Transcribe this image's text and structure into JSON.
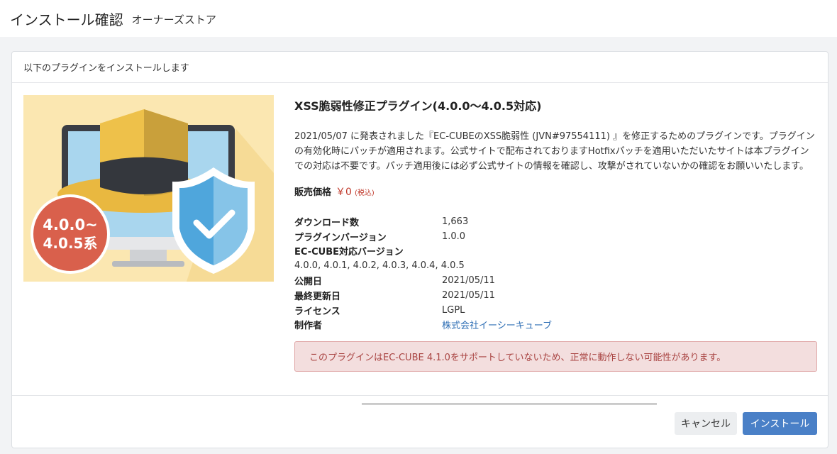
{
  "header": {
    "title": "インストール確認",
    "subtitle": "オーナーズストア"
  },
  "card": {
    "heading": "以下のプラグインをインストールします"
  },
  "plugin": {
    "image_badge_line1": "4.0.0~",
    "image_badge_line2": "4.0.5系",
    "title": "XSS脆弱性修正プラグイン(4.0.0〜4.0.5対応)",
    "description": "2021/05/07 に発表されました『EC-CUBEのXSS脆弱性 (JVN#97554111) 』を修正するためのプラグインです。プラグインの有効化時にパッチが適用されます。公式サイトで配布されておりますHotfixパッチを適用いただいたサイトは本プラグインでの対応は不要です。パッチ適用後には必ず公式サイトの情報を確認し、攻撃がされていないかの確認をお願いいたします。",
    "price_label": "販売価格",
    "price": "￥0",
    "price_tax": "(税込)",
    "meta": {
      "downloads_label": "ダウンロード数",
      "downloads": "1,663",
      "version_label": "プラグインバージョン",
      "version": "1.0.0",
      "eccube_versions_label": "EC-CUBE対応バージョン",
      "eccube_versions": "4.0.0, 4.0.1, 4.0.2, 4.0.3, 4.0.4, 4.0.5",
      "published_label": "公開日",
      "published": "2021/05/11",
      "updated_label": "最終更新日",
      "updated": "2021/05/11",
      "license_label": "ライセンス",
      "license": "LGPL",
      "author_label": "制作者",
      "author": "株式会社イーシーキューブ"
    },
    "warning": "このプラグインはEC-CUBE 4.1.0をサポートしていないため、正常に動作しない可能性があります。"
  },
  "footer": {
    "cancel_label": "キャンセル",
    "install_label": "インストール"
  },
  "colors": {
    "primary": "#4a80c7",
    "warning_bg": "#f3dede",
    "warning_text": "#a94442",
    "price": "#c0392b",
    "link": "#2f6fb5"
  }
}
